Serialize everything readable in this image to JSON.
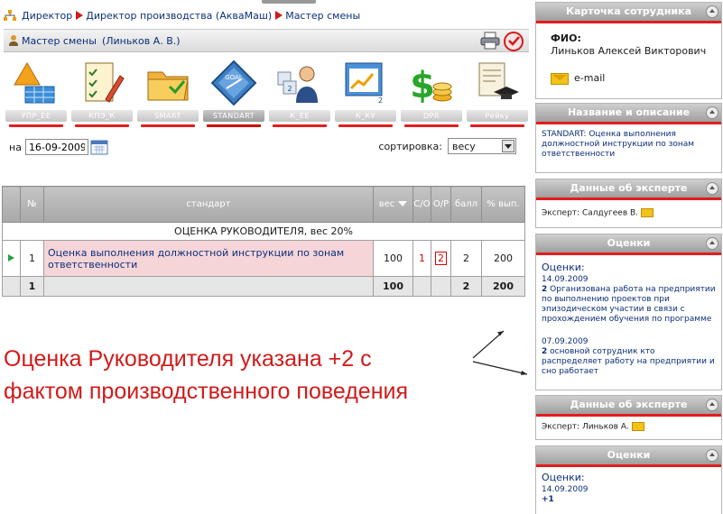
{
  "breadcrumb": [
    "Директор",
    "Директор производства (АкваМаш)",
    "Мастер смены"
  ],
  "panel": {
    "title": "Мастер смены",
    "person": "(Линьков А. В.)"
  },
  "modules": [
    {
      "icon": "warning-grid-icon",
      "label": "УПР_ЕЕ",
      "active": false
    },
    {
      "icon": "checklist-pencil-icon",
      "label": "КПЭ_К",
      "active": false
    },
    {
      "icon": "folder-icon",
      "label": "SMART",
      "active": false
    },
    {
      "icon": "goal-badge-icon",
      "label": "STANDART",
      "active": true
    },
    {
      "icon": "person-chart-icon",
      "label": "К_ЕЕ",
      "active": false
    },
    {
      "icon": "calendar-chart-icon",
      "label": "К_КУ",
      "active": false
    },
    {
      "icon": "money-icon",
      "label": "DPR",
      "active": false
    },
    {
      "icon": "diploma-icon",
      "label": "Рейку",
      "active": false
    }
  ],
  "filters": {
    "date_label": "на",
    "date_value": "16-09-2009",
    "sort_label": "сортировка:",
    "sort_value": "весу"
  },
  "table": {
    "headers": [
      "№",
      "стандарт",
      "вес",
      "С/О",
      "О/Р",
      "балл",
      "% вып."
    ],
    "group_title": "ОЦЕНКА РУКОВОДИТЕЛЯ, вес 20%",
    "rows": [
      {
        "n": "1",
        "standard": "Оценка выполнения должностной инструкции по зонам ответственности",
        "weight": "100",
        "co": "1",
        "or": "2",
        "score": "2",
        "pct": "200"
      }
    ],
    "total": {
      "n": "1",
      "weight": "100",
      "score": "2",
      "pct": "200"
    }
  },
  "annotation": "Оценка Руководителя указана +2 с фактом производственного поведения",
  "annotation_lines": [
    "Оценка Руководителя указана +2 с",
    "фактом производственного поведения"
  ],
  "right": {
    "employee_card": {
      "title": "Карточка сотрудника",
      "fio_label": "ФИО:",
      "fio": "Линьков Алексей Викторович",
      "email": "e-mail"
    },
    "description": {
      "title": "Название и описание",
      "text": "STANDART: Оценка выполнения должностной инструкции по зонам ответственности"
    },
    "expert1": {
      "title": "Данные об эксперте",
      "text": "Эксперт: Салдугеев В."
    },
    "grades1": {
      "title": "Оценки",
      "label": "Оценки:",
      "entries": [
        {
          "date": "14.09.2009",
          "score": "2",
          "text": "Организована работа на предприятии по выполнению проектов при эпизодическом участии в связи с прохождением обучения по программе"
        },
        {
          "date": "07.09.2009",
          "score": "2",
          "text": "основной сотрудник кто распределяет работу на предприятии и сно работает"
        }
      ]
    },
    "expert2": {
      "title": "Данные об эксперте",
      "text": "Эксперт: Линьков А."
    },
    "grades2": {
      "title": "Оценки",
      "label": "Оценки:",
      "entries": [
        {
          "date": "14.09.2009",
          "score": "+1"
        }
      ]
    }
  }
}
